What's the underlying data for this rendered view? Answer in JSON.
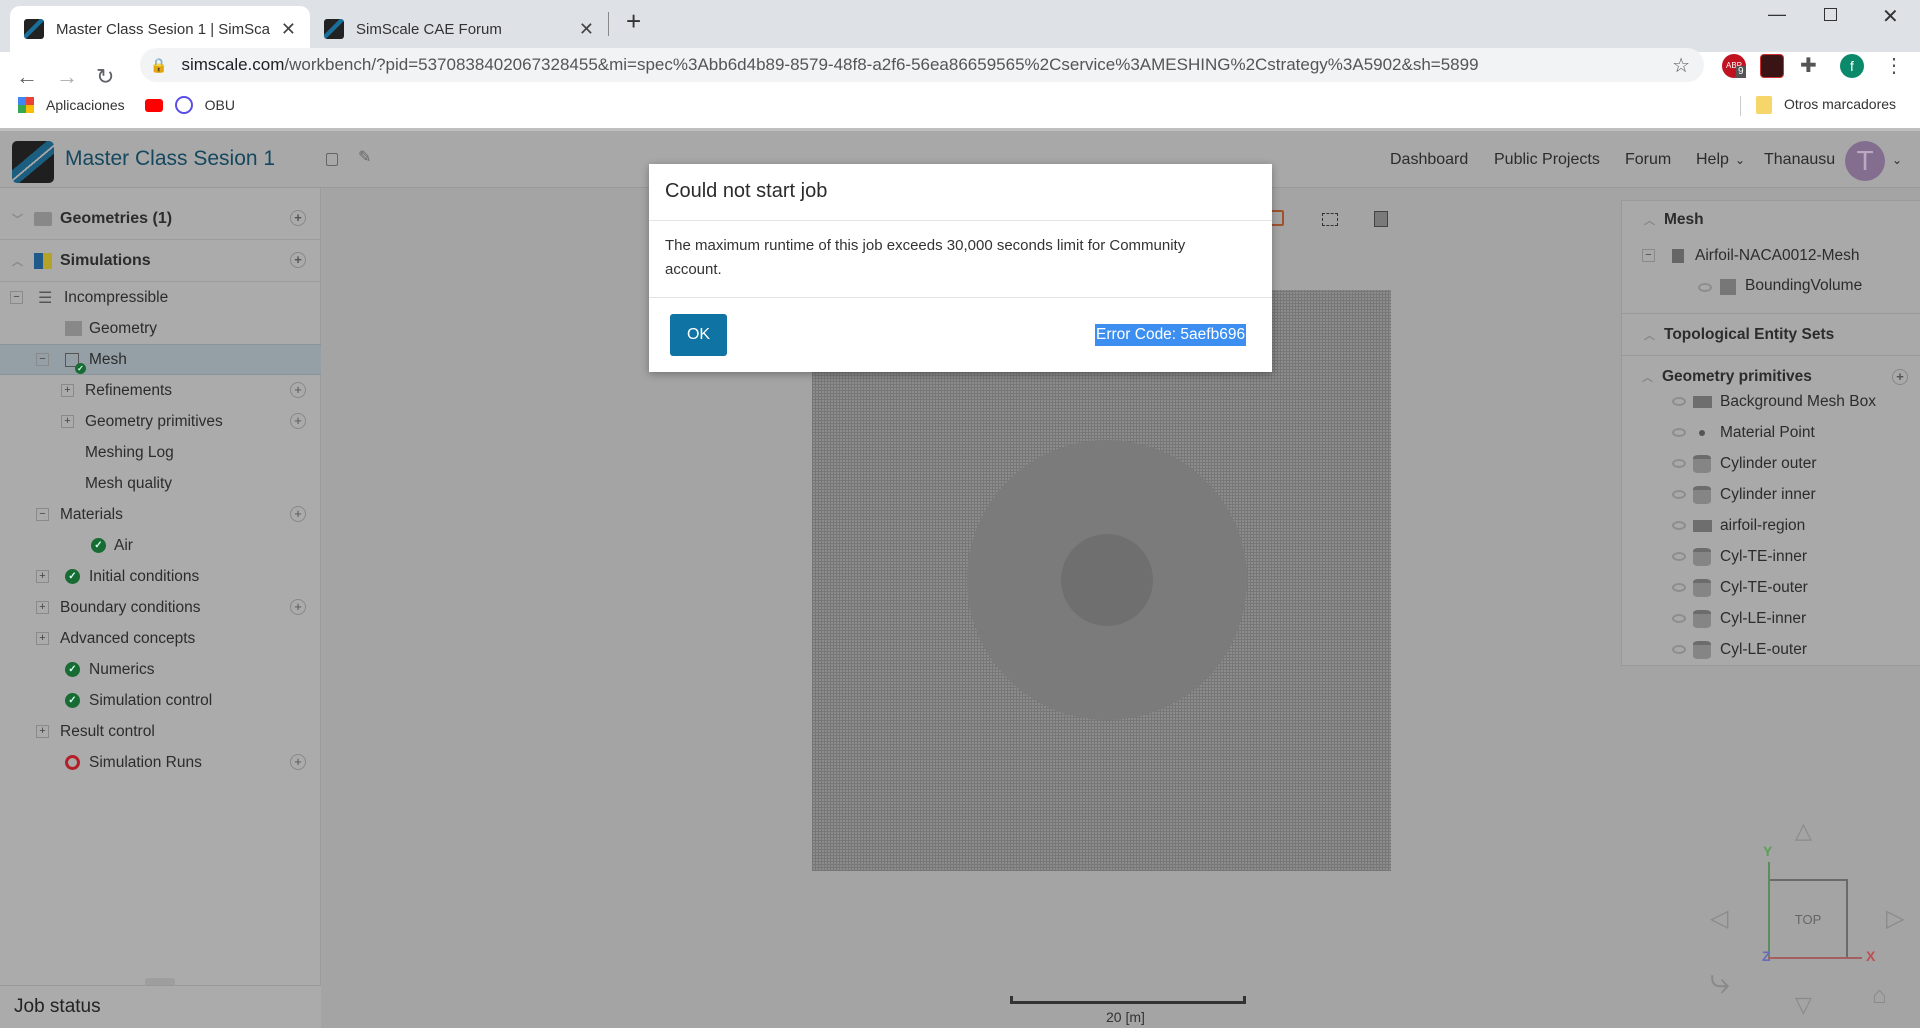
{
  "browser": {
    "tabs": [
      {
        "title": "Master Class Sesion 1 | SimScale",
        "active": true
      },
      {
        "title": "SimScale CAE Forum",
        "active": false
      }
    ],
    "url_host": "simscale.com",
    "url_path": "/workbench/?pid=5370838402067328455&mi=spec%3Abb6d4b89-8579-48f8-a2f6-56ea86659565%2Cservice%3AMESHING%2Cstrategy%3A5902&sh=5899",
    "abp_badge": "9",
    "profile_initial": "f",
    "bookmarks": [
      "Aplicaciones",
      "OBU"
    ],
    "other_bookmarks": "Otros marcadores"
  },
  "header": {
    "project_title": "Master Class Sesion 1",
    "nav": [
      "Dashboard",
      "Public Projects",
      "Forum",
      "Help",
      "Thanausu"
    ],
    "avatar_initial": "T"
  },
  "sidebar": {
    "geometries": "Geometries (1)",
    "simulations": "Simulations",
    "tree": [
      "Incompressible",
      "Geometry",
      "Mesh",
      "Refinements",
      "Geometry primitives",
      "Meshing Log",
      "Mesh quality",
      "Materials",
      "Air",
      "Initial conditions",
      "Boundary conditions",
      "Advanced concepts",
      "Numerics",
      "Simulation control",
      "Result control",
      "Simulation Runs"
    ],
    "job_status": "Job status"
  },
  "right_panel": {
    "mesh_header": "Mesh",
    "mesh_name": "Airfoil-NACA0012-Mesh",
    "bounding": "BoundingVolume",
    "topological": "Topological Entity Sets",
    "primitives_header": "Geometry primitives",
    "primitives": [
      "Background Mesh Box",
      "Material Point",
      "Cylinder outer",
      "Cylinder inner",
      "airfoil-region",
      "Cyl-TE-inner",
      "Cyl-TE-outer",
      "Cyl-LE-inner",
      "Cyl-LE-outer"
    ]
  },
  "viewport": {
    "scale_label": "20 [m]",
    "view_label": "TOP",
    "axes": {
      "x": "X",
      "y": "Y",
      "z": "Z"
    }
  },
  "dialog": {
    "title": "Could not start job",
    "message": "The maximum runtime of this job exceeds 30,000 seconds limit for Community account.",
    "ok_label": "OK",
    "error_code": "Error Code: 5aefb696"
  }
}
